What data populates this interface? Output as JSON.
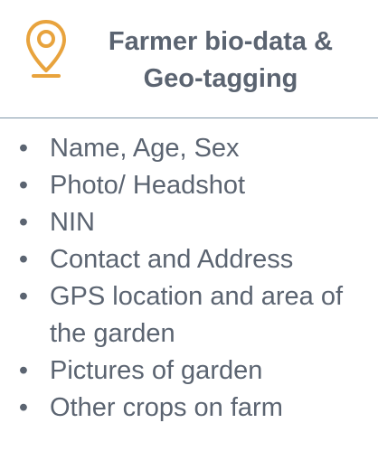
{
  "header": {
    "icon": "map-pin-icon",
    "accent_color": "#e8a33d",
    "title_line1": "Farmer bio-data &",
    "title_line2": "Geo-tagging"
  },
  "list": {
    "bullet_glyph": "•",
    "items": [
      "Name, Age, Sex",
      "Photo/ Headshot",
      "NIN",
      "Contact and Address",
      "GPS location and area of the garden",
      "Pictures of garden",
      "Other crops on farm"
    ]
  }
}
